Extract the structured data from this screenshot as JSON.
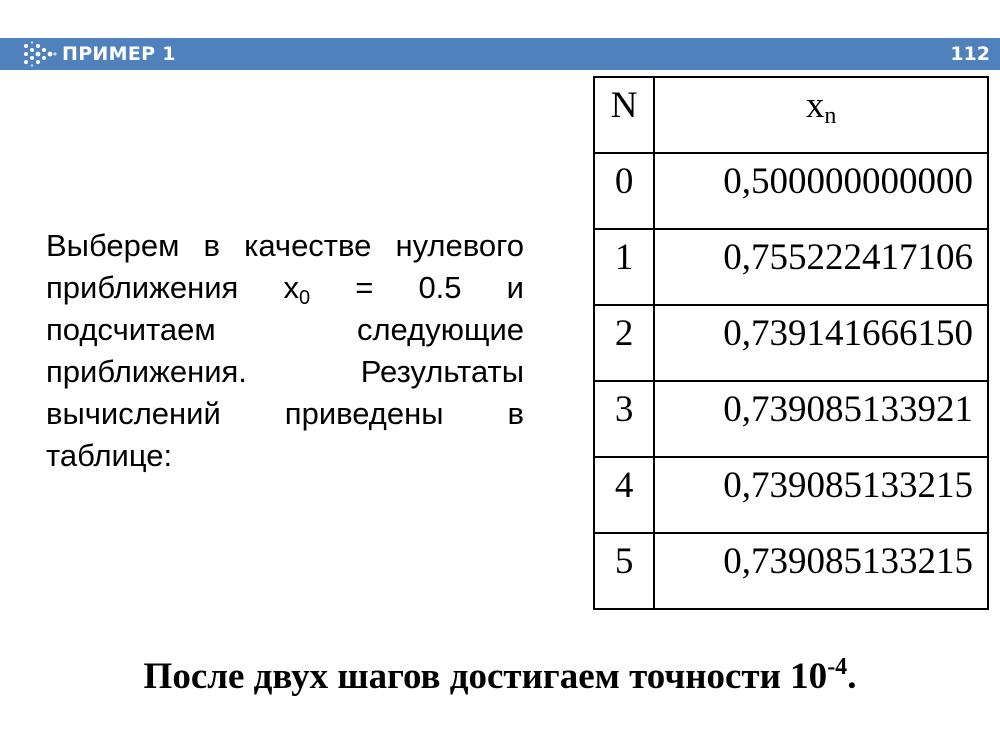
{
  "header": {
    "title": "ПРИМЕР 1",
    "slide_number": "112",
    "bar_color": "#4f81bd",
    "logo": "dotted-chevron-icon"
  },
  "intro": {
    "part1": "Выберем в качестве нулевого приближения x",
    "subscript": "0",
    "part2": " = 0.5 и подсчитаем следующие приближения. Результаты вычислений приведены в таблице:"
  },
  "table": {
    "headers": {
      "n": "N",
      "x": "x",
      "x_sub": "n"
    },
    "rows": [
      {
        "n": "0",
        "x": "0,500000000000"
      },
      {
        "n": "1",
        "x": "0,755222417106"
      },
      {
        "n": "2",
        "x": "0,739141666150"
      },
      {
        "n": "3",
        "x": "0,739085133921"
      },
      {
        "n": "4",
        "x": "0,739085133215"
      },
      {
        "n": "5",
        "x": "0,739085133215"
      }
    ]
  },
  "conclusion": {
    "text": "После двух шагов достигаем точности 10",
    "exponent": "-4",
    "end": "."
  }
}
